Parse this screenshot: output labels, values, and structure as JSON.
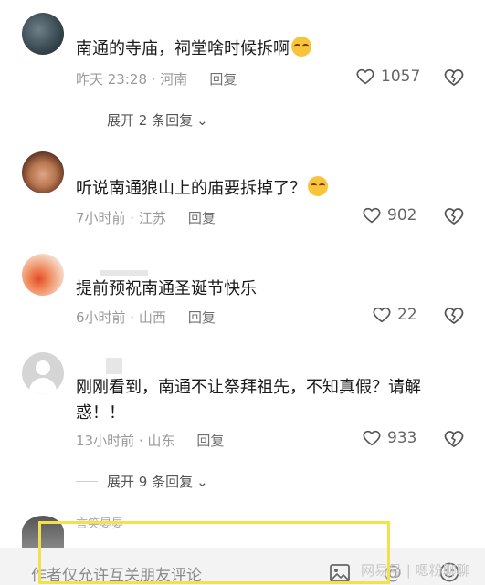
{
  "comments": [
    {
      "text": "南通的寺庙，祠堂啥时候拆啊",
      "time": "昨天 23:28 · 河南",
      "reply": "回复",
      "likes": "1057",
      "expand": "展开 2 条回复"
    },
    {
      "text": "听说南通狼山上的庙要拆掉了？",
      "time": "7小时前 · 江苏",
      "reply": "回复",
      "likes": "902"
    },
    {
      "text": "提前预祝南通圣诞节快乐",
      "time": "6小时前 · 山西",
      "reply": "回复",
      "likes": "22"
    },
    {
      "text": "刚刚看到，南通不让祭拜祖先，不知真假？请解惑！！",
      "time": "13小时前 · 山东",
      "reply": "回复",
      "likes": "933",
      "expand": "展开 9 条回复"
    }
  ],
  "partial": {
    "name": "言笑晏晏"
  },
  "input": {
    "placeholder": "作者仅允许互关朋友评论"
  },
  "watermark": "网易号 | 嗯粉聊聊",
  "icons": {
    "like": "heart-outline-icon",
    "dislike": "broken-heart-icon",
    "chevron": "chevron-down-icon",
    "image": "image-icon",
    "at": "at-icon",
    "emoji": "emoji-icon"
  }
}
